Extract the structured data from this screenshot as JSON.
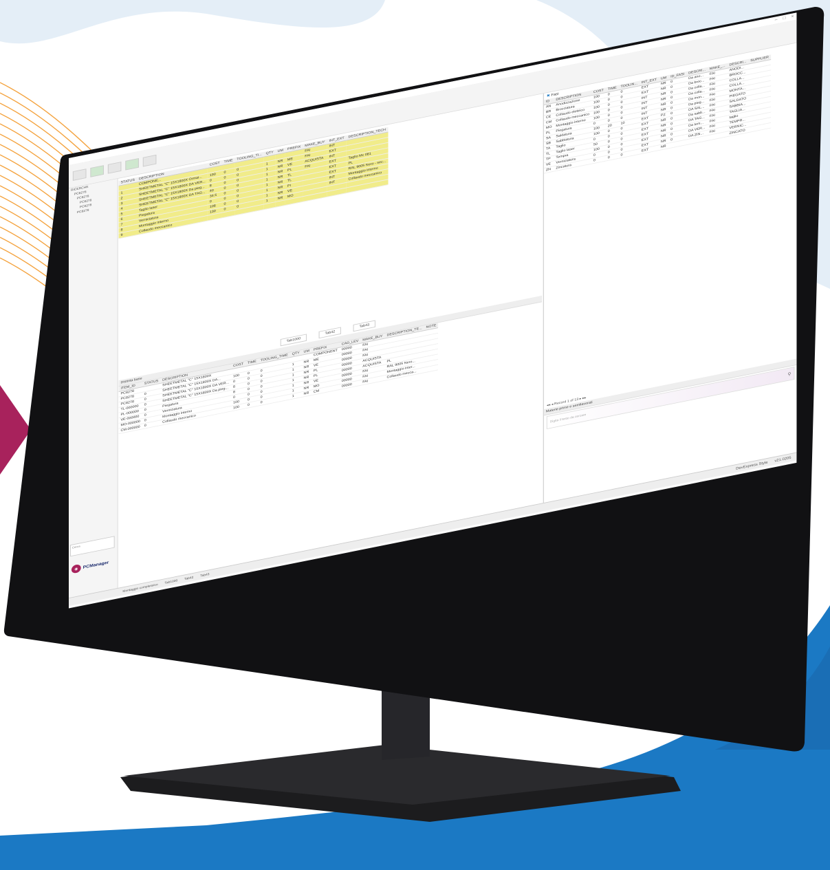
{
  "colors": {
    "brand": "#a8225c",
    "accent_blue": "#1b79c4",
    "highlight": "#f1ec8a",
    "orange_wave": "#f39a2b"
  },
  "window": {
    "minimize": "–",
    "maximize": "□",
    "close": "×"
  },
  "ribbon": {
    "buttons": [
      "",
      "",
      "",
      "",
      ""
    ]
  },
  "sidebar": {
    "nodes": [
      "RICERCHE",
      "PC8278",
      "PC8278",
      "PC8278",
      "PC8278",
      "PC8278"
    ],
    "search_label": "Cerca",
    "brand_name": "PCManager"
  },
  "top_grid": {
    "columns": [
      "STATUS",
      "DESCRIPTION",
      "COST",
      "TIME",
      "TOOLING_TI...",
      "QTY",
      "UM",
      "PREFIX",
      "MAKE_BUY",
      "INT_EXT",
      "DESCRIPTION_TECH"
    ],
    "rows": [
      [
        "",
        "COMPONE...",
        "",
        "",
        "",
        "",
        "",
        "",
        "FAI",
        "INT",
        ""
      ],
      [
        "1",
        "SHEETMETAL \"C\" 15X1800X Ormai...",
        "190",
        "0",
        "0",
        "1",
        "NR",
        "ME",
        "FAI",
        "EXT",
        ""
      ],
      [
        "2",
        "SHEETMETAL \"C\" 15X1800X DA VER...",
        "0",
        "0",
        "0",
        "1",
        "NR",
        "VE",
        "ACQUISTA",
        "INT",
        ""
      ],
      [
        "3",
        "SHEETMETAL \"C\" 15X1800X Da pieg...",
        "8",
        "0",
        "0",
        "1",
        "NR",
        "PL",
        "FAI",
        "EXT",
        "Taglio Mc 081"
      ],
      [
        "4",
        "SHEETMETAL \"C\" 15X1800X DA TAG...",
        "40",
        "0",
        "0",
        "1",
        "NR",
        "TL",
        "",
        "EXT",
        "PL"
      ],
      [
        "5",
        "Taglio laser",
        "34.5",
        "0",
        "0",
        "1",
        "NR",
        "TL",
        "",
        "EXT",
        "RAL 9005 Nero - sec..."
      ],
      [
        "6",
        "Piegatura",
        "0",
        "0",
        "0",
        "1",
        "NR",
        "PI",
        "",
        "INT",
        "Montaggio interno"
      ],
      [
        "7",
        "Verniciatura",
        "108",
        "0",
        "0",
        "1",
        "NR",
        "VE",
        "",
        "INT",
        "Collaudo meccanico"
      ],
      [
        "8",
        "Montaggio interno",
        "130",
        "0",
        "0",
        "1",
        "NR",
        "MO",
        "",
        "",
        ""
      ],
      [
        "9",
        "Collaudo meccanico",
        "",
        "",
        "",
        "",
        "",
        "",
        "",
        "",
        ""
      ]
    ]
  },
  "mid_tabs": [
    "Tab1000",
    "Tab42",
    "Tab43"
  ],
  "bottom_grid": {
    "caption": "Distinta base",
    "columns": [
      "ITEM_ID",
      "STATUS",
      "DESCRIPTION",
      "COST",
      "TIME",
      "TOOLING_TIME",
      "QTY",
      "UM",
      "PREFIX",
      "CAD_LEV",
      "MAKE_BUY",
      "DESCRIPTION_TE...",
      "NOTE"
    ],
    "rows": [
      [
        "PC8278",
        "",
        "SHEETMETAL \"C\" 15X1800X",
        "",
        "",
        "",
        "",
        "",
        "COMPONENT",
        "00000",
        "FAI",
        "",
        ""
      ],
      [
        "PC8278",
        "0",
        "SHEETMETAL \"C\" 15X1800X DA...",
        "100",
        "0",
        "0",
        "1",
        "NR",
        "ME",
        "00000",
        "FAI",
        "",
        ""
      ],
      [
        "PC8278",
        "0",
        "SHEETMETAL \"C\" 15X1800X DA VER...",
        "0",
        "0",
        "0",
        "1",
        "NR",
        "VE",
        "00000",
        "FAI",
        "",
        ""
      ],
      [
        "TL-000000",
        "0",
        "SHEETMETAL \"C\" 15X1800X Da pieg...",
        "8",
        "0",
        "0",
        "1",
        "NR",
        "PL",
        "00000",
        "ACQUISTA",
        "",
        ""
      ],
      [
        "PL-000000",
        "0",
        "Piegatura",
        "8",
        "0",
        "0",
        "1",
        "NR",
        "PL",
        "00000",
        "ACQUISTA",
        "PL",
        ""
      ],
      [
        "VE-000000",
        "0",
        "Verniciatura",
        "0",
        "0",
        "0",
        "1",
        "NR",
        "VE",
        "00000",
        "FAI",
        "RAL 9005 Nero...",
        ""
      ],
      [
        "MO-000000",
        "0",
        "Montaggio interno",
        "100",
        "0",
        "0",
        "1",
        "NR",
        "MO",
        "00000",
        "FAI",
        "Montaggio inter...",
        ""
      ],
      [
        "CM-000000",
        "0",
        "Collaudo meccanico",
        "100",
        "0",
        "0",
        "1",
        "NR",
        "CM",
        "00000",
        "FAI",
        "Collaudo mecca...",
        ""
      ]
    ]
  },
  "right_grid": {
    "title": "Fasi",
    "columns": [
      "ID",
      "DESCRIPTION",
      "COST",
      "TIME",
      "TOOLIN...",
      "INT_EXT",
      "UM",
      "ID_FASI",
      "DESCRI...",
      "MAKE_...",
      "DESCRI...",
      "SUPPLIER"
    ],
    "rows": [
      [
        "AN",
        "Anodizzazione",
        "100",
        "0",
        "0",
        "EXT",
        "NR",
        "0",
        "Da ano...",
        "FAI",
        "ANODI...",
        ""
      ],
      [
        "BR",
        "Brocciatura",
        "100",
        "0",
        "0",
        "EXT",
        "NR",
        "0",
        "Da broc...",
        "FAI",
        "BROCC...",
        ""
      ],
      [
        "CE",
        "Collaudo elettrico",
        "100",
        "0",
        "0",
        "INT",
        "NR",
        "0",
        "Da colla...",
        "FAI",
        "COLLA...",
        ""
      ],
      [
        "CM",
        "Collaudo meccanico",
        "100",
        "0",
        "0",
        "INT",
        "NR",
        "0",
        "Da colla...",
        "FAI",
        "COLLA...",
        ""
      ],
      [
        "MO",
        "Montaggio interno",
        "100",
        "0",
        "0",
        "INT",
        "NR",
        "0",
        "Da mon...",
        "FAI",
        "MONTA...",
        ""
      ],
      [
        "PL",
        "Piegatura",
        "0",
        "0",
        "0",
        "INT",
        "NR",
        "0",
        "Da pieg...",
        "FAI",
        "PIEGATO",
        ""
      ],
      [
        "SA",
        "Saldatura",
        "100",
        "20",
        "10",
        "EXT",
        "PZ",
        "0",
        "DA SAL...",
        "FAI",
        "SALDATO",
        ""
      ],
      [
        "SB",
        "Sabbiatura",
        "100",
        "0",
        "0",
        "EXT",
        "NR",
        "0",
        "Da sabb...",
        "FAI",
        "SABBIA...",
        ""
      ],
      [
        "TA",
        "Taglio",
        "0",
        "0",
        "0",
        "EXT",
        "NR",
        "0",
        "DA TAG...",
        "FAI",
        "TAGLIA...",
        ""
      ],
      [
        "TL",
        "Taglio laser",
        "50",
        "0",
        "0",
        "EXT",
        "NR",
        "0",
        "Da tem...",
        "FAI",
        "taglio",
        ""
      ],
      [
        "TP",
        "Tempra",
        "100",
        "0",
        "0",
        "EXT",
        "NR",
        "0",
        "DA VER...",
        "FAI",
        "TEMPR...",
        ""
      ],
      [
        "VE",
        "Verniciatura",
        "0",
        "0",
        "0",
        "EXT",
        "NR",
        "0",
        "DA ZIN...",
        "FAI",
        "VERNIC...",
        ""
      ],
      [
        "ZN",
        "Zincatura",
        "0",
        "0",
        "0",
        "EXT",
        "NR",
        "",
        "",
        "",
        "ZINCATO",
        ""
      ]
    ],
    "pager": "Record 1 of 13",
    "panel_caption": "Materie prime e semilavorati",
    "search_placeholder": "Digita il testo da cercare"
  },
  "statusbar": {
    "left_text": "Montaggio complessivo",
    "tabs": [
      "Tab1000",
      "Tab42",
      "Tab43"
    ],
    "skin": "DevExpress Style",
    "version": "v21.0205"
  }
}
